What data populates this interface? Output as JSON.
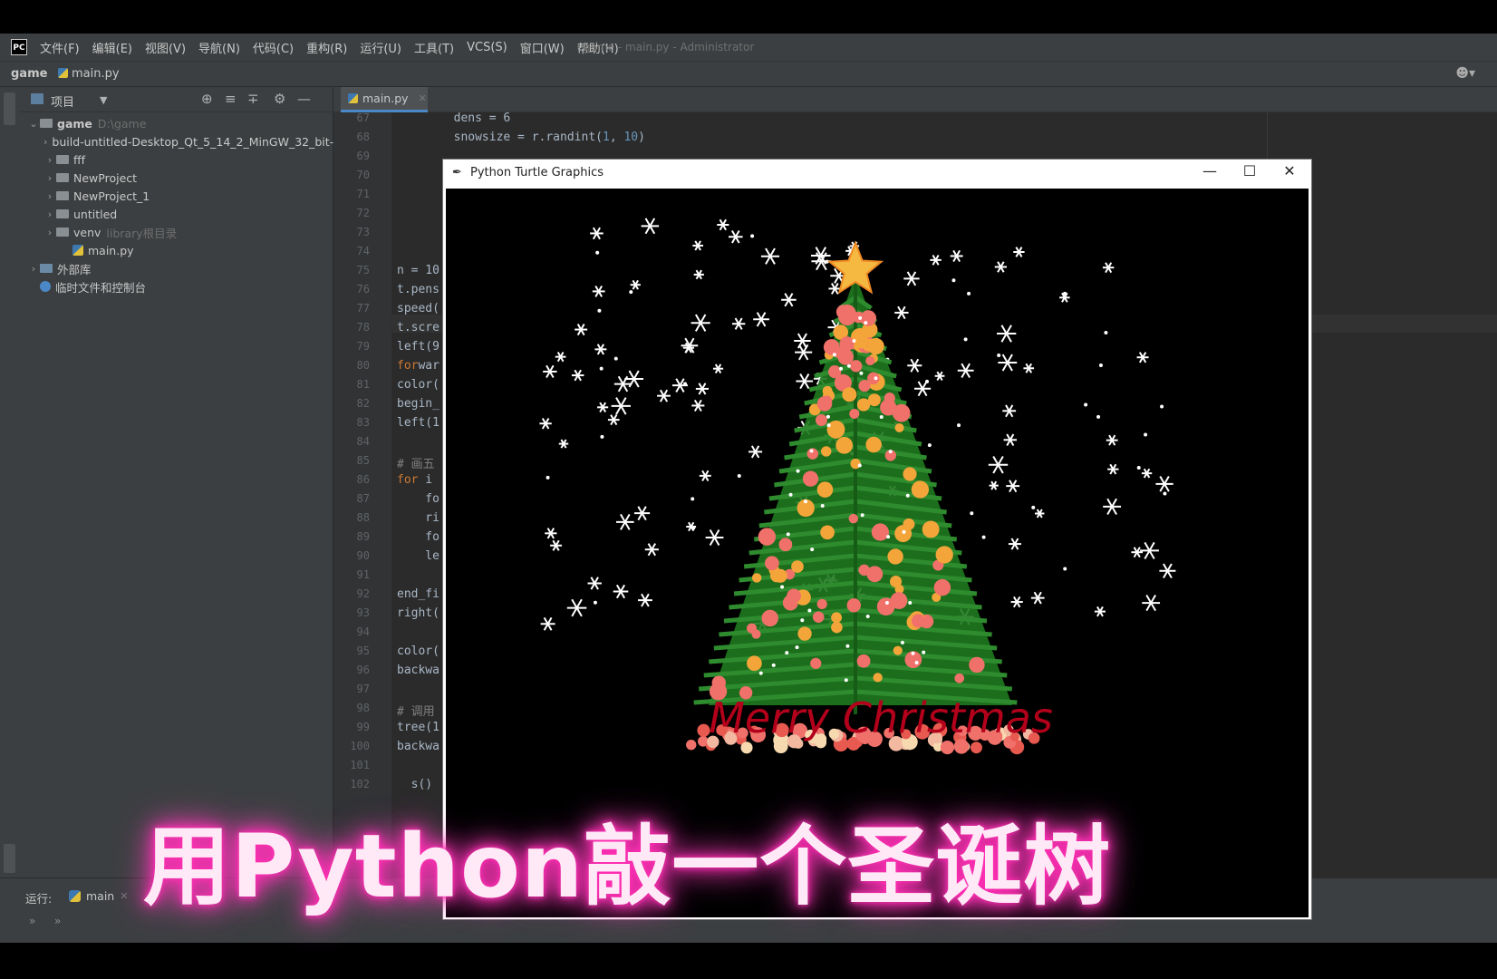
{
  "ide": {
    "logo": "PC",
    "menu": [
      "文件(F)",
      "编辑(E)",
      "视图(V)",
      "导航(N)",
      "代码(C)",
      "重构(R)",
      "运行(U)",
      "工具(T)",
      "VCS(S)",
      "窗口(W)",
      "帮助(H)"
    ],
    "window_title": "game - main.py - Administrator",
    "breadcrumb": [
      "game",
      "main.py"
    ],
    "project_panel": {
      "title": "项目",
      "tree": [
        {
          "label": "game",
          "hint": "D:\\game",
          "kind": "folder",
          "expanded": true,
          "depth": 0
        },
        {
          "label": "build-untitled-Desktop_Qt_5_14_2_MinGW_32_bit-",
          "hint": "",
          "kind": "folder",
          "expanded": false,
          "depth": 1
        },
        {
          "label": "fff",
          "hint": "",
          "kind": "folder",
          "expanded": false,
          "depth": 1
        },
        {
          "label": "NewProject",
          "hint": "",
          "kind": "folder",
          "expanded": false,
          "depth": 1
        },
        {
          "label": "NewProject_1",
          "hint": "",
          "kind": "folder",
          "expanded": false,
          "depth": 1
        },
        {
          "label": "untitled",
          "hint": "",
          "kind": "folder",
          "expanded": false,
          "depth": 1
        },
        {
          "label": "venv",
          "hint": "library根目录",
          "kind": "folder",
          "expanded": false,
          "depth": 1
        },
        {
          "label": "main.py",
          "hint": "",
          "kind": "file",
          "depth": 2
        },
        {
          "label": "外部库",
          "hint": "",
          "kind": "lib",
          "expanded": false,
          "depth": 0
        },
        {
          "label": "临时文件和控制台",
          "hint": "",
          "kind": "scratch",
          "depth": 0
        }
      ]
    },
    "editor_tab": "main.py",
    "code_lines": [
      {
        "n": "67",
        "text": "        dens = 6"
      },
      {
        "n": "68",
        "text": "        snowsize = r.randint(1, 10)"
      },
      {
        "n": "69",
        "text": ""
      },
      {
        "n": "70",
        "text": ""
      },
      {
        "n": "71",
        "text": ""
      },
      {
        "n": "72",
        "text": ""
      },
      {
        "n": "73",
        "text": ""
      },
      {
        "n": "74",
        "text": ""
      },
      {
        "n": "75",
        "text": "n = 10"
      },
      {
        "n": "76",
        "text": "t.pens"
      },
      {
        "n": "77",
        "text": "speed("
      },
      {
        "n": "78",
        "text": "t.scre"
      },
      {
        "n": "79",
        "text": "left(9"
      },
      {
        "n": "80",
        "text": "forwar"
      },
      {
        "n": "81",
        "text": "color("
      },
      {
        "n": "82",
        "text": "begin_"
      },
      {
        "n": "83",
        "text": "left(1"
      },
      {
        "n": "84",
        "text": ""
      },
      {
        "n": "85",
        "text": "# 画五"
      },
      {
        "n": "86",
        "text": "for i "
      },
      {
        "n": "87",
        "text": "    fo"
      },
      {
        "n": "88",
        "text": "    ri"
      },
      {
        "n": "89",
        "text": "    fo"
      },
      {
        "n": "90",
        "text": "    le"
      },
      {
        "n": "91",
        "text": ""
      },
      {
        "n": "92",
        "text": "end_fi"
      },
      {
        "n": "93",
        "text": "right("
      },
      {
        "n": "94",
        "text": ""
      },
      {
        "n": "95",
        "text": "color("
      },
      {
        "n": "96",
        "text": "backwa"
      },
      {
        "n": "97",
        "text": ""
      },
      {
        "n": "98",
        "text": "# 调用"
      },
      {
        "n": "99",
        "text": "tree(1"
      },
      {
        "n": "100",
        "text": "backwa"
      },
      {
        "n": "101",
        "text": ""
      },
      {
        "n": "102",
        "text": "  s()"
      }
    ],
    "run_panel": {
      "label": "运行:",
      "tab": "main"
    }
  },
  "turtle_window": {
    "title": "Python Turtle Graphics",
    "canvas_text": "Merry Christmas"
  },
  "overlay_caption": "用Python敲一个圣诞树",
  "colors": {
    "ide_bg": "#2b2b2b",
    "panel_bg": "#3c3f41",
    "tree_green": "#1f7a1f",
    "ornament_orange": "#f4a53a",
    "ornament_pink": "#f0706a",
    "star_gold": "#f5b942",
    "text_red": "#b3001b",
    "caption_glow": "#ff2fb4"
  }
}
